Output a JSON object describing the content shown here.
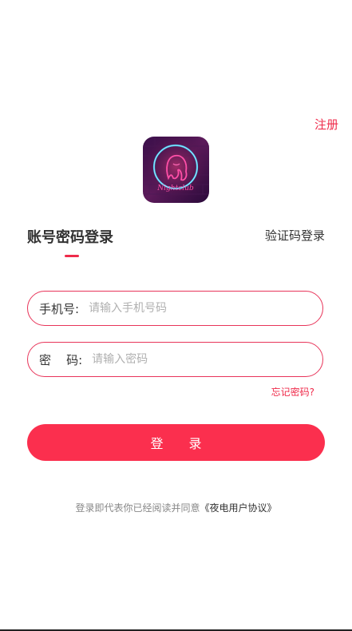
{
  "header": {
    "register_label": "注册"
  },
  "logo": {
    "icon": "nightclub-logo-icon",
    "script_text": "Nightclub"
  },
  "tabs": {
    "password_login": "账号密码登录",
    "code_login": "验证码登录"
  },
  "form": {
    "phone": {
      "label": "手机号:",
      "placeholder": "请输入手机号码",
      "value": ""
    },
    "password": {
      "label": "密    码:",
      "placeholder": "请输入密码",
      "value": ""
    },
    "forgot_label": "忘记密码?"
  },
  "login_button": {
    "label": "登　　录"
  },
  "agreement": {
    "prefix": "登录即代表你已经阅读并同意",
    "link": "《夜电用户协议》"
  },
  "colors": {
    "accent": "#ef2b4b",
    "button": "#fb2f4e",
    "border": "#e8355a"
  }
}
